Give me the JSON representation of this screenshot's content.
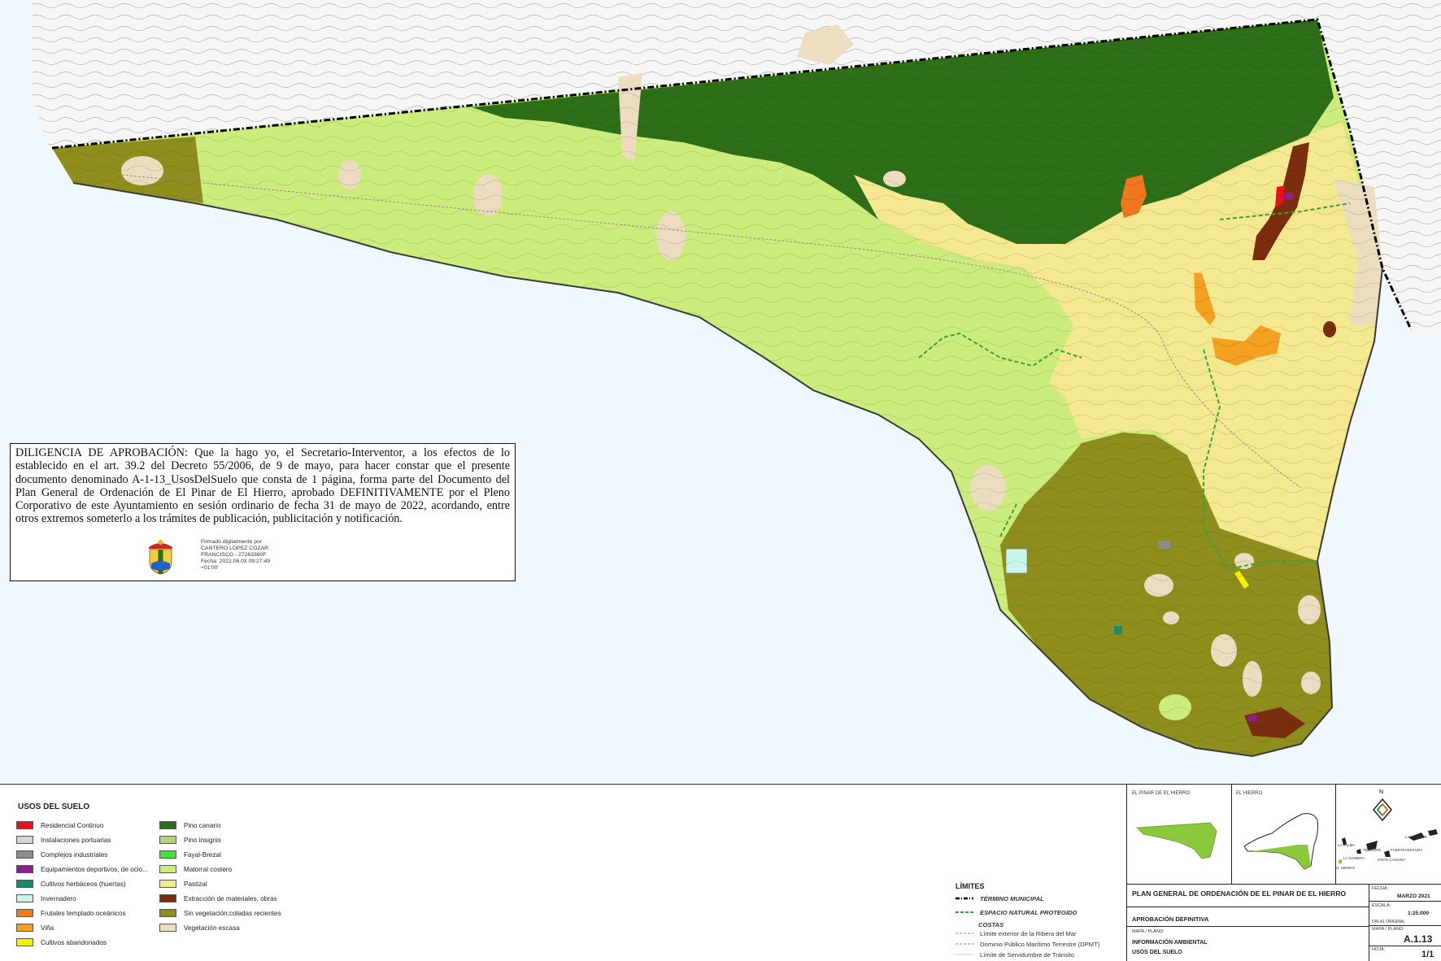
{
  "diligencia": {
    "text": "DILIGENCIA DE APROBACIÓN: Que la hago yo, el Secretario-Interventor, a los efectos de lo establecido en el art. 39.2 del Decreto 55/2006, de 9 de mayo, para hacer constar que el presente documento denominado A-1-13_UsosDelSuelo que consta de 1 página, forma parte del Documento del Plan General de Ordenación de El Pinar de El Hierro, aprobado DEFINITIVAMENTE por el Pleno Corporativo de este Ayuntamiento en sesión ordinario de fecha 31 de mayo de 2022, acordando, entre otros extremos someterlo a los trámites de publicación, publicitación y notificación.",
    "signature": {
      "line1": "Firmado digitalmente por",
      "line2": "CANTERO LOPEZ COZAR",
      "line3": "FRANCISCO - 27263380F",
      "line4": "Fecha: 2022.06.03 09:27:49",
      "line5": "+01'00'"
    }
  },
  "legend": {
    "title": "USOS DEL SUELO",
    "col1": [
      {
        "label": "Residencial Continuo",
        "color": "#e8101c"
      },
      {
        "label": "Instalaciones portuarias",
        "color": "#d8d4d0"
      },
      {
        "label": "Complejos industriales",
        "color": "#8c8c8c"
      },
      {
        "label": "Equipamientos deportivos, de ocio...",
        "color": "#8e1e8e"
      },
      {
        "label": "Cultivos herbáceos (huertas)",
        "color": "#1a8c6c"
      },
      {
        "label": "Invernadero",
        "color": "#c8f4ec"
      },
      {
        "label": "Frutales templado oceánicos",
        "color": "#f0781e"
      },
      {
        "label": "Viña",
        "color": "#f4a020"
      },
      {
        "label": "Cultivos abandonados",
        "color": "#f4f000"
      }
    ],
    "col2": [
      {
        "label": "Pino canario",
        "color": "#2e6e18"
      },
      {
        "label": "Pino insignis",
        "color": "#b4d478"
      },
      {
        "label": "Fayal-Brezal",
        "color": "#44e040"
      },
      {
        "label": "Matorral costero",
        "color": "#cdec7e"
      },
      {
        "label": "Pastizal",
        "color": "#f4e890"
      },
      {
        "label": "Extracción de materiales, obras",
        "color": "#7a2e0e"
      },
      {
        "label": "Sin vegetación;coladas recientes",
        "color": "#8e8e1e"
      },
      {
        "label": "Vegetación escasa",
        "color": "#ecdcc0"
      }
    ]
  },
  "limits": {
    "title": "LÍMITES",
    "termino": "TÉRMINO MUNICIPAL",
    "espacio": "ESPACIO NATURAL PROTEGIDO",
    "costas": "COSTAS",
    "ribera": "Límite exterior de la Ribera del Mar",
    "dpmt": "Dominio Público Marítimo Terrestre (DPMT)",
    "servidumbre": "Límite de Servidumbre de Tránsito"
  },
  "titleblock": {
    "loc1": "EL PINAR DE EL HIERRO",
    "loc2": "EL HIERRO",
    "north": "N",
    "islands": {
      "la_palma": "LA PALMA",
      "tenerife": "TENERIFE",
      "lanzarote": "LANZAROTE",
      "fuerteventura": "FUERTEVENTURA",
      "gran_canaria": "GRAN CANARIA",
      "la_gomera": "LA GOMERA",
      "el_hierro": "EL HIERRO"
    },
    "plan_title": "PLAN GENERAL DE ORDENACIÓN DE EL PINAR DE EL HIERRO",
    "aprobacion": "APROBACIÓN DEFINITIVA",
    "mapa_label": "MAPA / PLANO:",
    "info": "INFORMACIÓN AMBIENTAL",
    "usos": "USOS DEL SUELO",
    "fecha_label": "FECHA:",
    "fecha": "MARZO 2021",
    "escala_label": "ESCALA:",
    "escala": "1:25.000",
    "din": "DIN A1 ORIGINAL",
    "plano_label": "MAPA / PLANO:",
    "plano": "A.1.13",
    "hoja_label": "HOJA:",
    "hoja": "1/1"
  },
  "colors": {
    "sea": "#f0f7fd",
    "outside": "#f4f4f4"
  }
}
